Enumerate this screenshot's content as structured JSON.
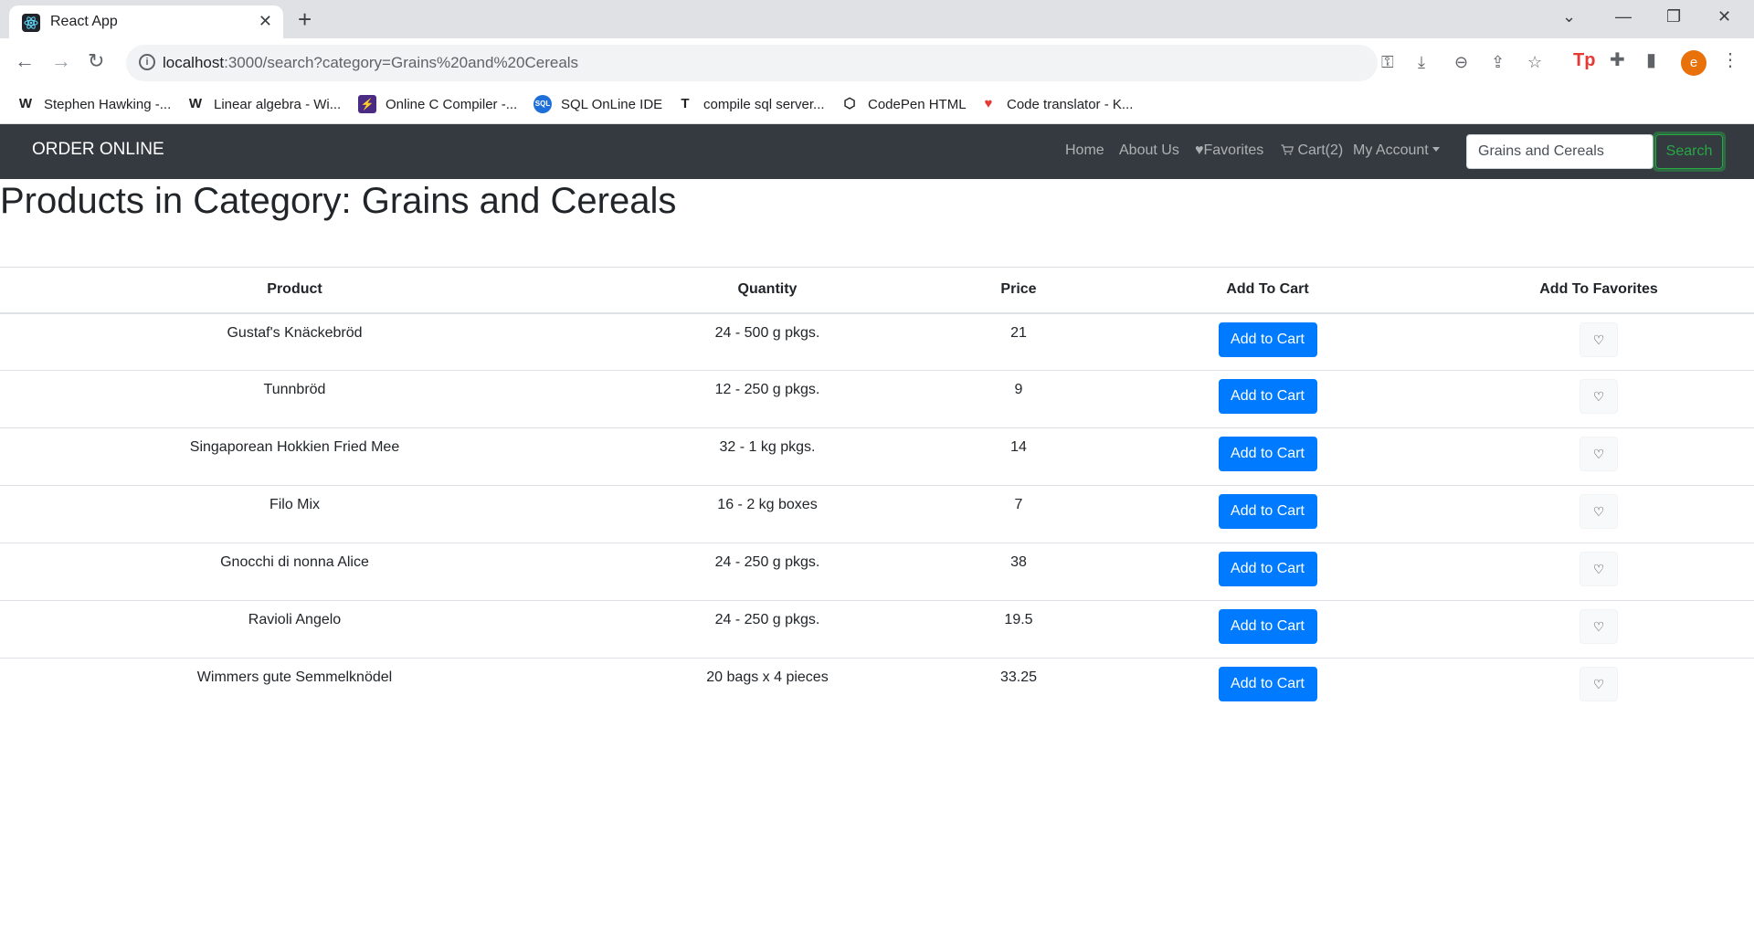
{
  "browser": {
    "tab_title": "React App",
    "url_host": "localhost",
    "url_rest": ":3000/search?category=Grains%20and%20Cereals",
    "profile_initial": "e",
    "bookmarks": [
      {
        "label": "Stephen Hawking -...",
        "icon": "W"
      },
      {
        "label": "Linear algebra - Wi...",
        "icon": "W"
      },
      {
        "label": "Online C Compiler -...",
        "icon": "⚡"
      },
      {
        "label": "SQL OnLine IDE",
        "icon": "SQL"
      },
      {
        "label": "compile sql server...",
        "icon": "T"
      },
      {
        "label": "CodePen HTML",
        "icon": "⬡"
      },
      {
        "label": "Code translator - K...",
        "icon": "♥"
      }
    ]
  },
  "nav": {
    "brand": "ORDER ONLINE",
    "home": "Home",
    "about": "About Us",
    "favorites": "Favorites",
    "cart": "Cart(2)",
    "account": "My Account",
    "search_value": "Grains and Cereals",
    "search_button": "Search"
  },
  "page": {
    "title": "Products in Category: Grains and Cereals"
  },
  "table": {
    "headers": {
      "product": "Product",
      "quantity": "Quantity",
      "price": "Price",
      "add_to_cart": "Add To Cart",
      "add_to_favorites": "Add To Favorites"
    },
    "add_to_cart_label": "Add to Cart",
    "rows": [
      {
        "product": "Gustaf's Knäckebröd",
        "quantity": "24 - 500 g pkgs.",
        "price": "21"
      },
      {
        "product": "Tunnbröd",
        "quantity": "12 - 250 g pkgs.",
        "price": "9"
      },
      {
        "product": "Singaporean Hokkien Fried Mee",
        "quantity": "32 - 1 kg pkgs.",
        "price": "14"
      },
      {
        "product": "Filo Mix",
        "quantity": "16 - 2 kg boxes",
        "price": "7"
      },
      {
        "product": "Gnocchi di nonna Alice",
        "quantity": "24 - 250 g pkgs.",
        "price": "38"
      },
      {
        "product": "Ravioli Angelo",
        "quantity": "24 - 250 g pkgs.",
        "price": "19.5"
      },
      {
        "product": "Wimmers gute Semmelknödel",
        "quantity": "20 bags x 4 pieces",
        "price": "33.25"
      }
    ]
  },
  "colors": {
    "navbar": "#343a40",
    "primary": "#007bff",
    "success": "#28a745"
  }
}
